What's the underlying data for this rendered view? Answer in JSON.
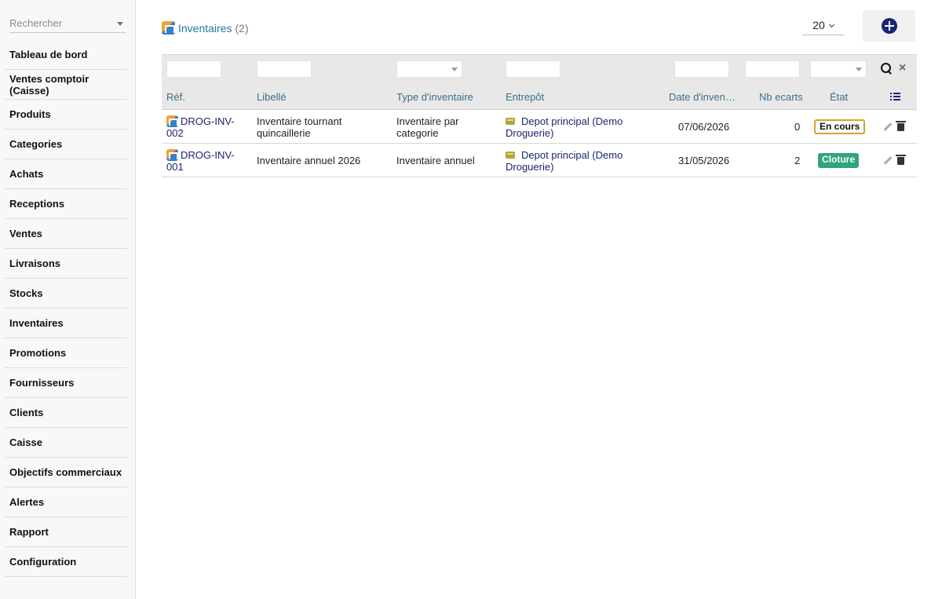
{
  "sidebar": {
    "search_placeholder": "Rechercher",
    "items": [
      {
        "label": "Tableau de bord"
      },
      {
        "label": "Ventes comptoir (Caisse)"
      },
      {
        "label": "Produits"
      },
      {
        "label": "Categories"
      },
      {
        "label": "Achats"
      },
      {
        "label": "Receptions"
      },
      {
        "label": "Ventes"
      },
      {
        "label": "Livraisons"
      },
      {
        "label": "Stocks"
      },
      {
        "label": "Inventaires"
      },
      {
        "label": "Promotions"
      },
      {
        "label": "Fournisseurs"
      },
      {
        "label": "Clients"
      },
      {
        "label": "Caisse"
      },
      {
        "label": "Objectifs commerciaux"
      },
      {
        "label": "Alertes"
      },
      {
        "label": "Rapport"
      },
      {
        "label": "Configuration"
      }
    ]
  },
  "header": {
    "title": "Inventaires",
    "count": "(2)",
    "page_size": "20"
  },
  "table": {
    "columns": {
      "ref": "Réf.",
      "libelle": "Libellé",
      "type": "Type d'inventaire",
      "entrepot": "Entrepôt",
      "date": "Date d'inven…",
      "ecarts": "Nb ecarts",
      "etat": "État"
    },
    "rows": [
      {
        "ref_line1": "DROG-INV-",
        "ref_line2": "002",
        "libelle_line1": "Inventaire tournant",
        "libelle_line2": "quincaillerie",
        "type_line1": "Inventaire par",
        "type_line2": "categorie",
        "entrepot_line1": "Depot principal (Demo",
        "entrepot_line2": "Droguerie)",
        "date": "07/06/2026",
        "ecarts": "0",
        "etat": "En cours"
      },
      {
        "ref_line1": "DROG-INV-",
        "ref_line2": "001",
        "libelle_line1": "Inventaire annuel 2026",
        "type_line1": "Inventaire annuel",
        "entrepot_line1": "Depot principal (Demo",
        "entrepot_line2": "Droguerie)",
        "date": "31/05/2026",
        "ecarts": "2",
        "etat": "Cloture"
      }
    ]
  },
  "colors": {
    "link": "#1a2470",
    "title_link": "#1f7a9e",
    "status_encours_border": "#d1a826",
    "status_cloture_bg": "#2fa57a"
  }
}
